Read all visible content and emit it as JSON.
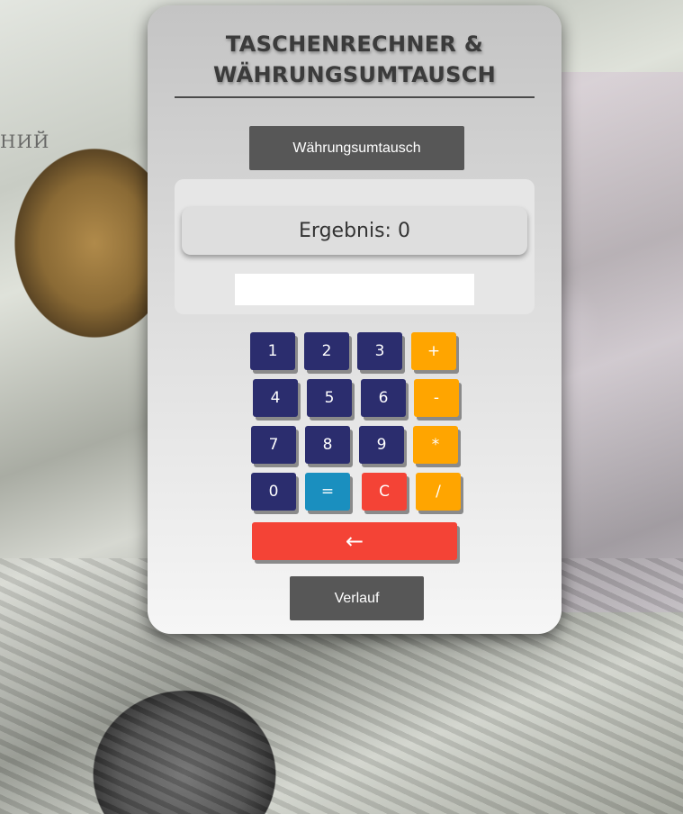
{
  "app": {
    "title": "TASCHENRECHNER &\nWÄHRUNGSUMTAUSCH"
  },
  "buttons": {
    "currency_exchange": "Währungsumtausch",
    "history": "Verlauf"
  },
  "display": {
    "result_label": "Ergebnis:",
    "result_value": "0",
    "input_value": ""
  },
  "keypad": {
    "k1": "1",
    "k2": "2",
    "k3": "3",
    "plus": "+",
    "k4": "4",
    "k5": "5",
    "k6": "6",
    "minus": "-",
    "k7": "7",
    "k8": "8",
    "k9": "9",
    "multiply": "*",
    "k0": "0",
    "equals": "=",
    "clear": "C",
    "divide": "/",
    "backspace": "←"
  },
  "colors": {
    "number_key": "#2b2d6e",
    "operator_key": "#ffa500",
    "equals_key": "#1a8fbf",
    "clear_key": "#f44336",
    "dark_button": "#575757"
  },
  "background": {
    "visible_text": "НИЙ"
  }
}
